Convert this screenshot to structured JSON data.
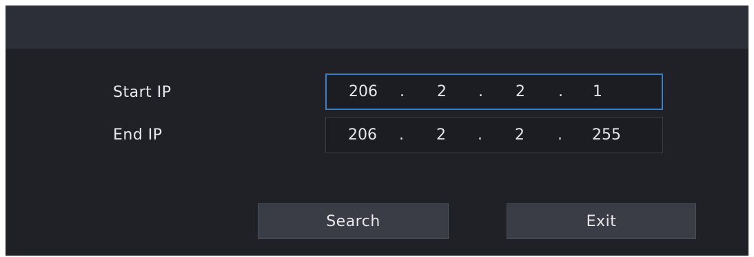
{
  "dialog": {
    "start_ip": {
      "label": "Start IP",
      "octets": [
        "206",
        "2",
        "2",
        "1"
      ],
      "separator": "."
    },
    "end_ip": {
      "label": "End IP",
      "octets": [
        "206",
        "2",
        "2",
        "255"
      ],
      "separator": "."
    },
    "buttons": {
      "search_label": "Search",
      "exit_label": "Exit"
    },
    "colors": {
      "background": "#1f2127",
      "header": "#2c2f38",
      "focus_border": "#3b7fc6",
      "button": "#3a3d46"
    }
  }
}
